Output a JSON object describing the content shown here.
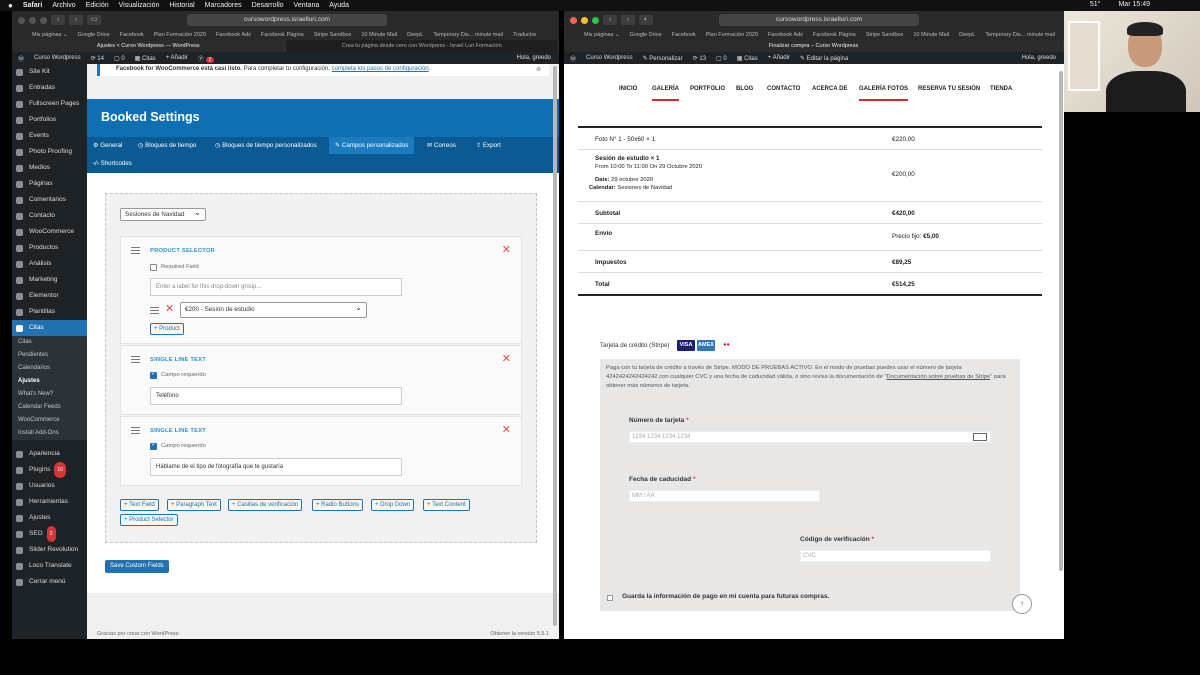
{
  "menubar": {
    "apple": "",
    "app": "Safari",
    "items": [
      "Archivo",
      "Edición",
      "Visualización",
      "Historial",
      "Marcadores",
      "Desarrollo",
      "Ventana",
      "Ayuda"
    ],
    "right_items": [
      "51°",
      "Mar 15:49"
    ]
  },
  "left_browser": {
    "url": "cursowordpress.israelluri.com",
    "bookmarks": [
      "Mis páginas ⌄",
      "Google Drive",
      "Facebook",
      "Plan Formación 2020",
      "Facebook Ads",
      "Facebook Página",
      "Stripe Sandbox",
      "10 Minute Mail",
      "DeepL",
      "Temporary Dis... minute mail",
      "Traductor"
    ],
    "tabs": [
      "Ajustes < Curso Wordpress — WordPress",
      "Crea tu página desde cero con Wordpress - Israel Luri Formación"
    ],
    "admin_bar": {
      "site": "Curso Wordpress",
      "updates": "14",
      "comments": "0",
      "bookings": "Citas",
      "new": "Añadir",
      "yoast_count": "2",
      "greeting": "Hola, greedo"
    }
  },
  "sidebar": {
    "items": [
      {
        "label": "Site Kit",
        "icon": "g-icon"
      },
      {
        "label": "Entradas",
        "icon": "pin-icon"
      },
      {
        "label": "Fullscreen Pages",
        "icon": "plus-icon"
      },
      {
        "label": "Portfolios",
        "icon": "folder-icon"
      },
      {
        "label": "Events",
        "icon": "calendar-icon"
      },
      {
        "label": "Photo Proofing",
        "icon": "camera-icon"
      },
      {
        "label": "Medios",
        "icon": "media-icon"
      },
      {
        "label": "Páginas",
        "icon": "page-icon"
      },
      {
        "label": "Comentarios",
        "icon": "comment-icon"
      },
      {
        "label": "Contacto",
        "icon": "mail-icon"
      },
      {
        "label": "WooCommerce",
        "icon": "woo-icon"
      },
      {
        "label": "Productos",
        "icon": "box-icon"
      },
      {
        "label": "Análisis",
        "icon": "chart-icon"
      },
      {
        "label": "Marketing",
        "icon": "megaphone-icon"
      },
      {
        "label": "Elementor",
        "icon": "elementor-icon"
      },
      {
        "label": "Plantillas",
        "icon": "template-icon"
      },
      {
        "label": "Citas",
        "icon": "calendar-icon"
      }
    ],
    "subitems": [
      "Citas",
      "Pendientes",
      "Calendarios",
      "Ajustes",
      "What's New?",
      "Calendar Feeds",
      "WooCommerce",
      "Install Add-Ons"
    ],
    "lower_items": [
      {
        "label": "Apariencia",
        "icon": "brush-icon"
      },
      {
        "label": "Plugins",
        "icon": "plug-icon",
        "badge": "10"
      },
      {
        "label": "Usuarios",
        "icon": "user-icon"
      },
      {
        "label": "Herramientas",
        "icon": "wrench-icon"
      },
      {
        "label": "Ajustes",
        "icon": "settings-icon"
      },
      {
        "label": "SEO",
        "icon": "yoast-icon",
        "badge": "2"
      },
      {
        "label": "Slider Revolution",
        "icon": "slider-icon"
      },
      {
        "label": "Loco Translate",
        "icon": "translate-icon"
      },
      {
        "label": "Cerrar menú",
        "icon": "collapse-icon"
      }
    ]
  },
  "notice": {
    "text": "Facebook for WooCommerce está casi listo.",
    "text2": " Para completar tu configuración, ",
    "link": "completa los pasos de configuración",
    "end": "."
  },
  "booked": {
    "title": "Booked Settings",
    "tabs": [
      "General",
      "Bloques de tiempo",
      "Bloques de tiempo personalizados",
      "Campos personalizados",
      "Correos",
      "Export",
      "Shortcodes"
    ],
    "calendar_select": "Sesiones de Navidad",
    "fields": [
      {
        "type": "PRODUCT SELECTOR",
        "check_label": "Required Field",
        "checked": false,
        "input": "Enter a label for this drop-down group...",
        "option": "€200 - Sesión de estudio",
        "add": "+ Product"
      },
      {
        "type": "SINGLE LINE TEXT",
        "check_label": "Campo requerido",
        "checked": true,
        "input": "Teléfono"
      },
      {
        "type": "SINGLE LINE TEXT",
        "check_label": "Campo requerido",
        "checked": true,
        "input": "Háblame de el tipo de fotografía que te gustaría"
      }
    ],
    "add_buttons": [
      "+ Text Field",
      "+ Paragraph Text",
      "+ Casillas de verificación",
      "+ Radio Buttons",
      "+ Drop Down",
      "+ Text Content",
      "+ Product Selector"
    ],
    "save": "Save Custom Fields",
    "footer_left": "Gracias por crear con WordPress.",
    "footer_right": "Obtener la versión 5.5.1"
  },
  "right_browser": {
    "url": "cursowordpress.israelluri.com",
    "bookmarks": [
      "Mis páginas ⌄",
      "Google Drive",
      "Facebook",
      "Plan Formación 2020",
      "Facebook Ads",
      "Facebook Página",
      "Stripe Sandbox",
      "10 Minute Mail",
      "DeepL",
      "Temporary Dis... minute mail"
    ],
    "tab": "Finalizar compra – Curso Wordpress",
    "admin_bar": {
      "site": "Curso Wordpress",
      "customize": "Personalizar",
      "updates": "13",
      "comments": "0",
      "bookings": "Citas",
      "new": "Añadir",
      "edit": "Editar la página",
      "greeting": "Hola, greedo"
    }
  },
  "site_nav": [
    "INICIO",
    "GALERÍA",
    "PORTFOLIO",
    "BLOG",
    "CONTACTO",
    "ACERCA DE",
    "GALERÍA FOTOS",
    "RESERVA TU SESIÓN",
    "TIENDA"
  ],
  "order": {
    "product_line": "Foto N° 1 - 50x60  × 1",
    "product_price": "€220,00",
    "session_title": "Sesión de estudio × 1",
    "session_time": "From 10:00 To 11:00 On 29 Octubre 2020",
    "date_label": "Date:",
    "date_value": "29 octubre 2020",
    "calendar_label": "Calendar:",
    "calendar_value": "Sesiones de Navidad",
    "session_price": "€200,00",
    "subtotal_label": "Subtotal",
    "subtotal": "€420,00",
    "shipping_label": "Envío",
    "shipping_prefix": "Precio fijo:",
    "shipping": "€5,00",
    "tax_label": "Impuestos",
    "tax": "€89,25",
    "total_label": "Total",
    "total": "€514,25"
  },
  "payment": {
    "method": "Tarjeta de crédito (Stripe)",
    "cards": [
      "VISA",
      "AMEX",
      "MC"
    ],
    "desc1": "Paga con tu tarjeta de crédito a través de Stripe. MODO DE PRUEBAS ACTIVO. En el modo de pruebas puedes usar el número de tarjeta 4242424242424242 con cualquier CVC y una fecha de caducidad válida, o sino revisa la documentación de \"",
    "desc_link": "Documentación sobre pruebas de Stripe",
    "desc2": "\" para obtener más números de tarjeta.",
    "card_number_label": "Número de tarjeta",
    "card_number_ph": "1234 1234 1234 1234",
    "expiry_label": "Fecha de caducidad",
    "expiry_ph": "MM / AA",
    "cvc_label": "Código de verificación",
    "cvc_ph": "CVC",
    "required": "*",
    "save_label": "Guarda la información de pago en mi cuenta para futuras compras.",
    "to_top": "↑"
  },
  "colors": {
    "accent": "#2271b1",
    "booked_header": "#0e6fb3",
    "nav_underline": "#d42b2b"
  }
}
